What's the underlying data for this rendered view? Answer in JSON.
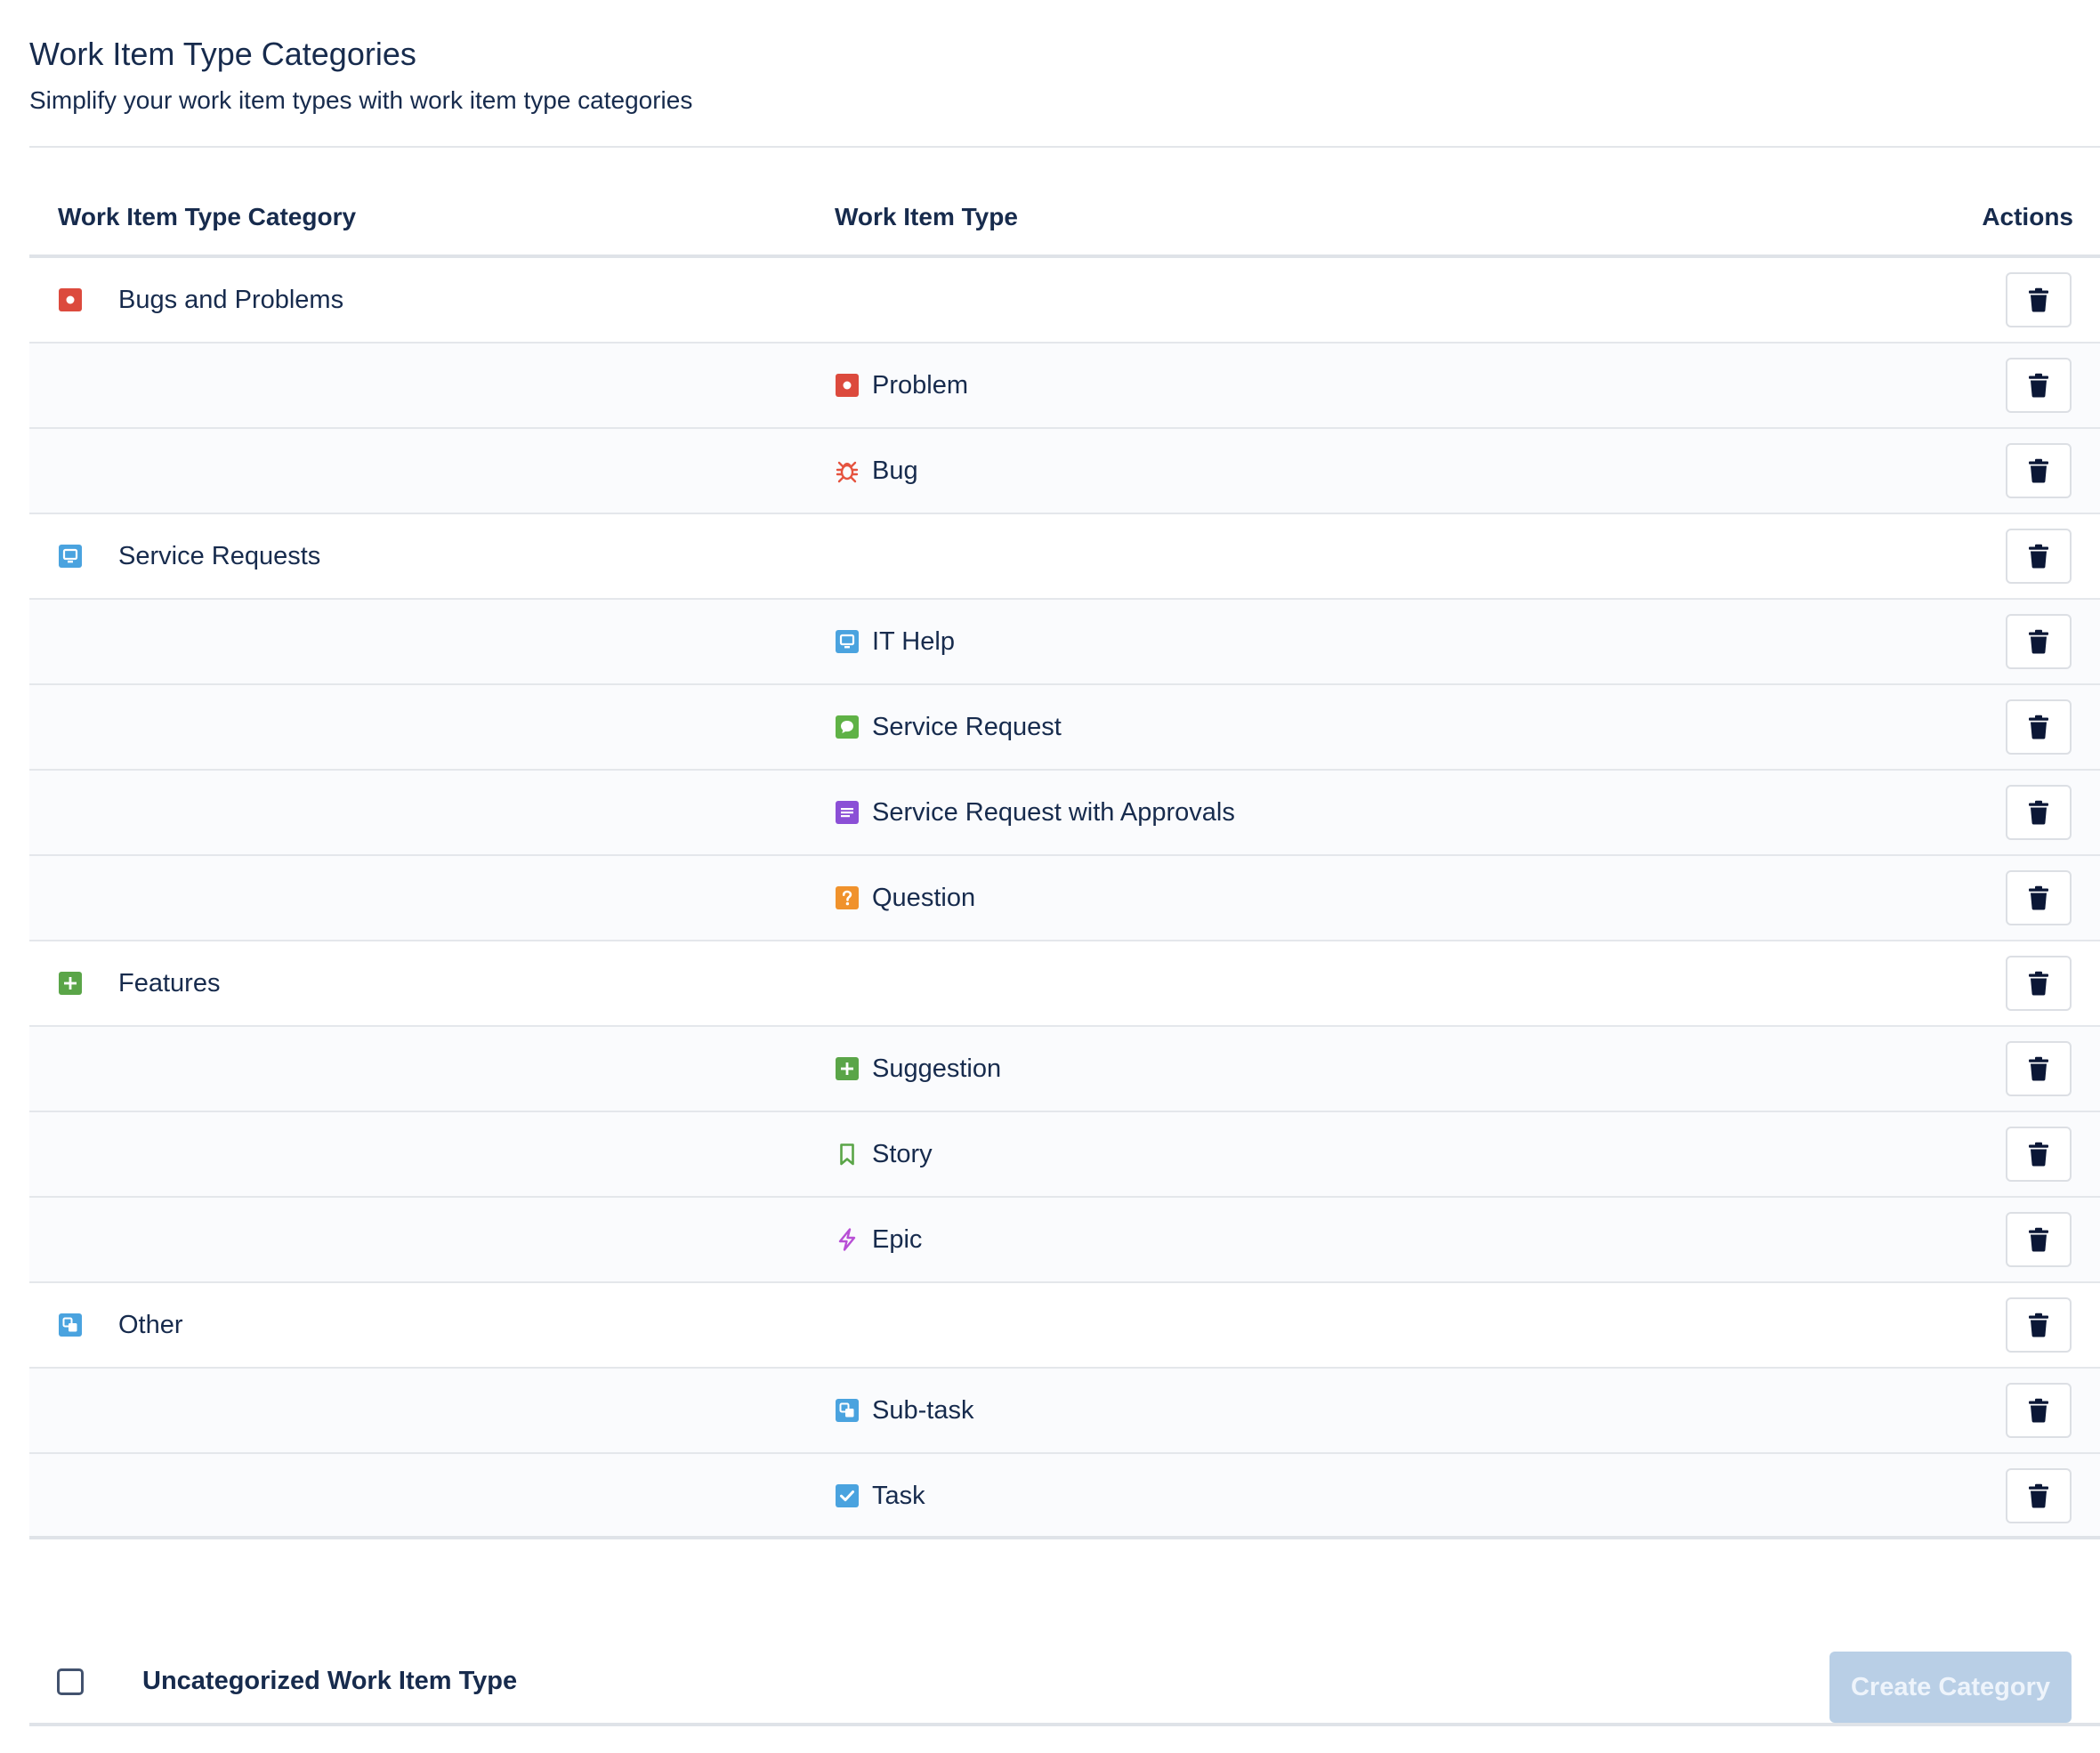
{
  "header": {
    "title": "Work Item Type Categories",
    "subtitle": "Simplify your work item types with work item type categories"
  },
  "table": {
    "columns": {
      "category": "Work Item Type Category",
      "type": "Work Item Type",
      "actions": "Actions"
    },
    "rows": [
      {
        "kind": "category",
        "label": "Bugs and Problems",
        "icon": "problem-icon",
        "color": "#dc4a3d"
      },
      {
        "kind": "type",
        "label": "Problem",
        "icon": "problem-icon",
        "color": "#dc4a3d"
      },
      {
        "kind": "type",
        "label": "Bug",
        "icon": "bug-icon",
        "color": "#e5533f"
      },
      {
        "kind": "category",
        "label": "Service Requests",
        "icon": "monitor-icon",
        "color": "#4aa3df"
      },
      {
        "kind": "type",
        "label": "IT Help",
        "icon": "monitor-icon",
        "color": "#4aa3df"
      },
      {
        "kind": "type",
        "label": "Service Request",
        "icon": "chat-bubble-icon",
        "color": "#5fb246"
      },
      {
        "kind": "type",
        "label": "Service Request with Approvals",
        "icon": "document-lines-icon",
        "color": "#8b4fd6"
      },
      {
        "kind": "type",
        "label": "Question",
        "icon": "question-icon",
        "color": "#f0922c"
      },
      {
        "kind": "category",
        "label": "Features",
        "icon": "plus-icon",
        "color": "#5aa548"
      },
      {
        "kind": "type",
        "label": "Suggestion",
        "icon": "plus-icon",
        "color": "#5aa548"
      },
      {
        "kind": "type",
        "label": "Story",
        "icon": "bookmark-icon",
        "color": "#5aa548"
      },
      {
        "kind": "type",
        "label": "Epic",
        "icon": "lightning-icon",
        "color": "#b84fd6"
      },
      {
        "kind": "category",
        "label": "Other",
        "icon": "subtask-icon",
        "color": "#4aa3df"
      },
      {
        "kind": "type",
        "label": "Sub-task",
        "icon": "subtask-icon",
        "color": "#4aa3df"
      },
      {
        "kind": "type",
        "label": "Task",
        "icon": "checkbox-icon",
        "color": "#4aa3df"
      }
    ],
    "delete_icon": "trash-icon"
  },
  "footer": {
    "checkbox_checked": false,
    "label": "Uncategorized Work Item Type",
    "create_button": "Create Category",
    "create_button_disabled": true
  }
}
